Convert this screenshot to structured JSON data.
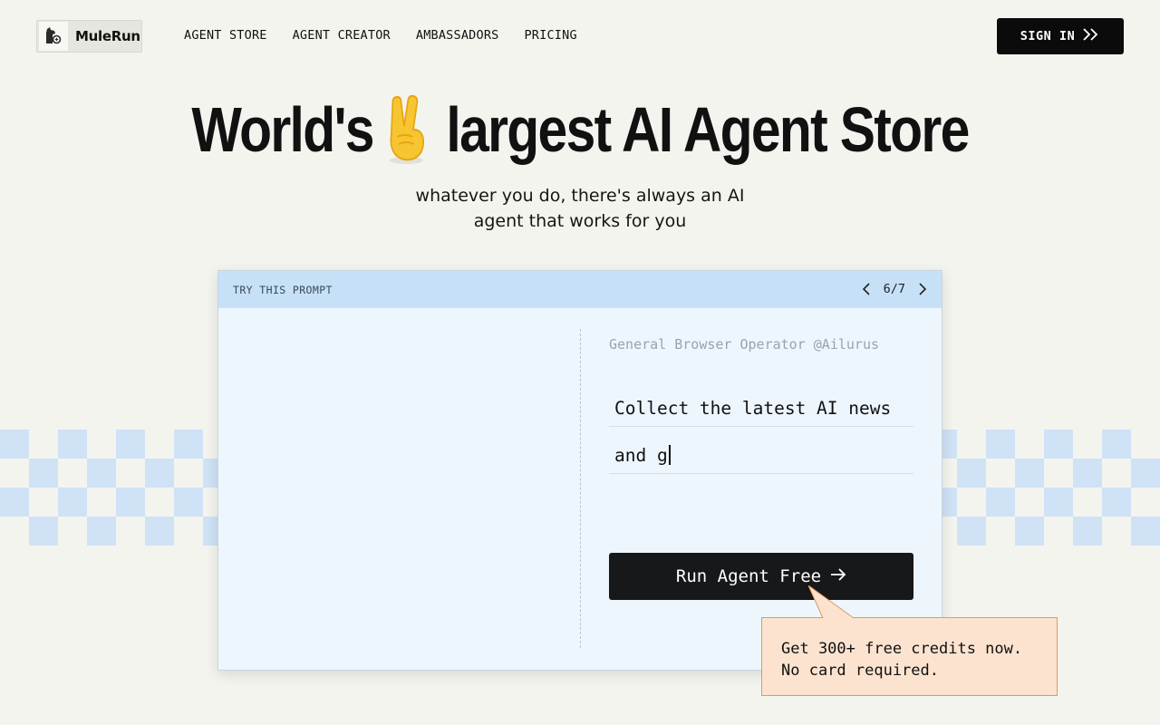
{
  "brand": {
    "name": "MuleRun"
  },
  "nav": {
    "items": [
      "AGENT STORE",
      "AGENT CREATOR",
      "AMBASSADORS",
      "PRICING"
    ],
    "signin_label": "SIGN IN"
  },
  "hero": {
    "title_left": "World's",
    "title_emoji": "victory-hand-emoji",
    "title_right": "largest AI Agent Store",
    "subtitle_line1": "whatever you do, there's always an AI",
    "subtitle_line2": "agent that works for you"
  },
  "prompt_card": {
    "header_label": "TRY THIS PROMPT",
    "pager": "6/7",
    "agent": "General Browser Operator @Ailurus",
    "prompt_line1": "Collect the latest AI news",
    "prompt_line2": "and g",
    "run_button_label": "Run Agent Free"
  },
  "tooltip": {
    "line1": "Get 300+ free credits now.",
    "line2": "No card required."
  },
  "colors": {
    "background": "#f4f4ef",
    "card_header": "#c6e0f7",
    "card_body": "#eef6fd",
    "checker_tile": "#cfe2f6",
    "button_dark": "#17181a",
    "tooltip_bg": "#fbe3cf",
    "tooltip_border": "#e09a58"
  }
}
